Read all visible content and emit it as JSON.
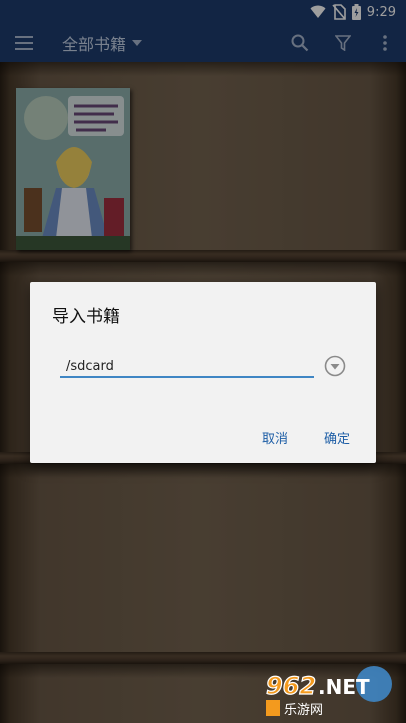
{
  "status_bar": {
    "time": "9:29",
    "icons": [
      "wifi-icon",
      "no-sim-icon",
      "battery-icon"
    ]
  },
  "app_bar": {
    "title": "全部书籍",
    "left_icon": "menu-icon",
    "actions": [
      "search-icon",
      "filter-icon",
      "more-vert-icon"
    ]
  },
  "bookshelf": {
    "books": [
      {
        "title_art": "Alice's Adventures in Wonderland"
      }
    ]
  },
  "dialog": {
    "title": "导入书籍",
    "path_value": "/sdcard",
    "cancel_label": "取消",
    "confirm_label": "确定"
  },
  "watermark": {
    "logo_text": "962.NET",
    "sub_text": "乐游网"
  },
  "colors": {
    "primary": "#1e3d6e",
    "accent": "#3f86c4",
    "dialog_button": "#1e5ea6"
  }
}
